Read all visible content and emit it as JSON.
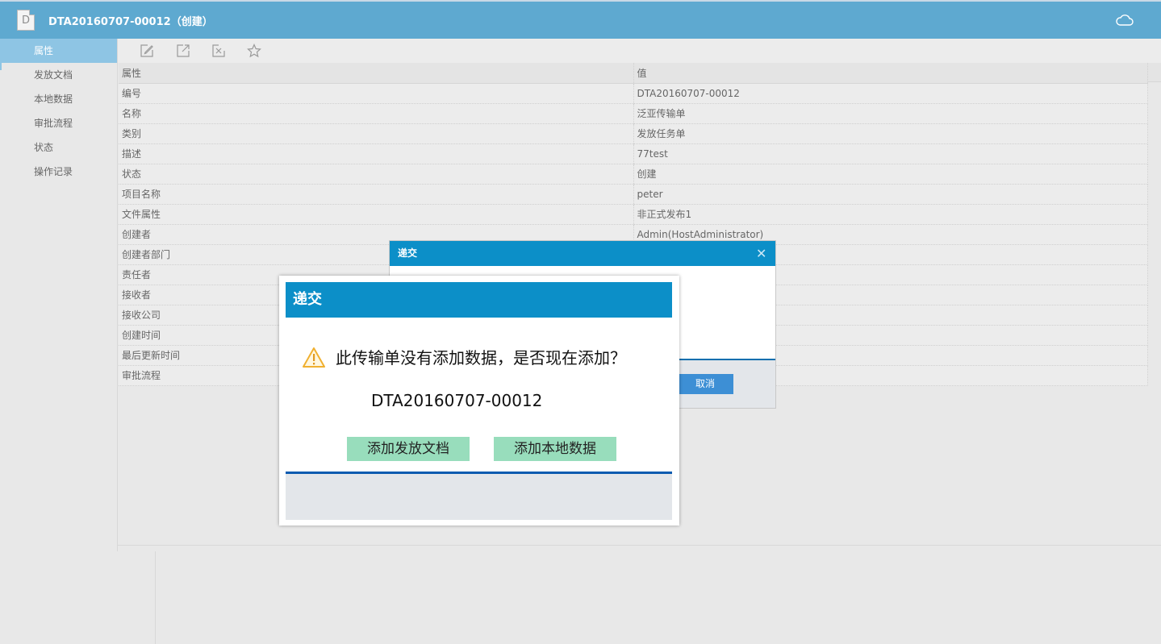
{
  "header": {
    "title": "DTA20160707-00012（创建）",
    "doc_icon_letter": "D",
    "icon": "cloud-icon"
  },
  "sidebar": {
    "items": [
      {
        "label": "属性",
        "active": true
      },
      {
        "label": "发放文档",
        "active": false
      },
      {
        "label": "本地数据",
        "active": false
      },
      {
        "label": "审批流程",
        "active": false
      },
      {
        "label": "状态",
        "active": false
      },
      {
        "label": "操作记录",
        "active": false
      }
    ]
  },
  "toolbar": {
    "icons": [
      "edit-icon",
      "export-icon",
      "delete-icon",
      "star-icon"
    ]
  },
  "table": {
    "headers": {
      "key": "属性",
      "value": "值"
    },
    "rows": [
      {
        "key": "编号",
        "value": "DTA20160707-00012"
      },
      {
        "key": "名称",
        "value": "泛亚传输单"
      },
      {
        "key": "类别",
        "value": "发放任务单"
      },
      {
        "key": "描述",
        "value": "77test"
      },
      {
        "key": "状态",
        "value": "创建"
      },
      {
        "key": "项目名称",
        "value": "peter"
      },
      {
        "key": "文件属性",
        "value": "非正式发布1"
      },
      {
        "key": "创建者",
        "value": "Admin(HostAdministrator)"
      },
      {
        "key": "创建者部门",
        "value": ""
      },
      {
        "key": "责任者",
        "value": ""
      },
      {
        "key": "接收者",
        "value": ""
      },
      {
        "key": "接收公司",
        "value": ""
      },
      {
        "key": "创建时间",
        "value": ""
      },
      {
        "key": "最后更新时间",
        "value": ""
      },
      {
        "key": "审批流程",
        "value": ""
      }
    ]
  },
  "back_dialog": {
    "title": "递交",
    "close_glyph": "✕",
    "cancel_label": "取消"
  },
  "front_dialog": {
    "title": "递交",
    "message": "此传输单没有添加数据，是否现在添加？",
    "doc_number": "DTA20160707-00012",
    "add_release_doc_label": "添加发放文档",
    "add_local_data_label": "添加本地数据",
    "warning_icon": "warning-icon"
  },
  "colors": {
    "titlebar": "#5ea9d0",
    "dialog_header": "#0c8fc8",
    "sidebar_active": "#8ec5e4",
    "action_button": "#98ddbc",
    "cancel_button": "#3d8fd5"
  }
}
